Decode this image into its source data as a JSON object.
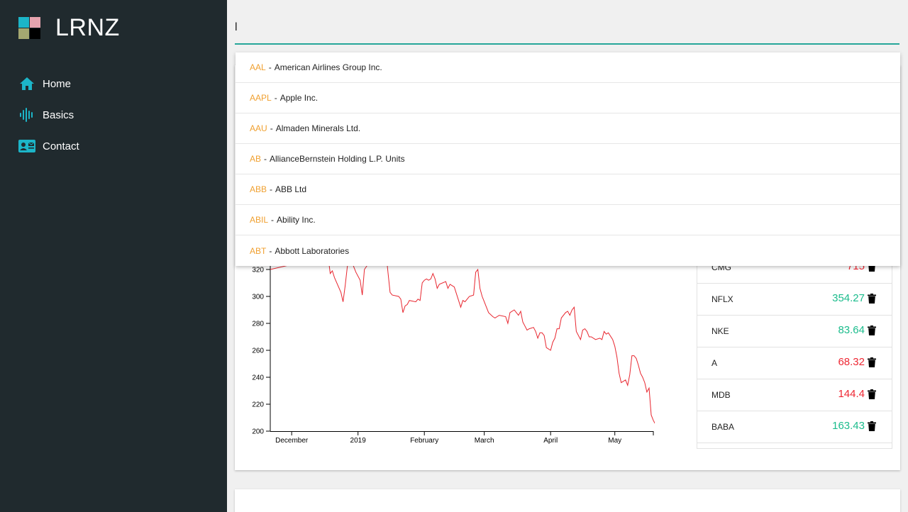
{
  "app": {
    "name": "LRNZ"
  },
  "colors": {
    "sidebar": "#202a2e",
    "accent": "#1cb5c8",
    "search_underline": "#26a69a",
    "symbol": "#f0a030",
    "up": "#1bbc8c",
    "down": "#ee2733",
    "line": "#e8262f"
  },
  "nav": {
    "items": [
      {
        "label": "Home",
        "icon": "home-icon"
      },
      {
        "label": "Basics",
        "icon": "waveform-icon"
      },
      {
        "label": "Contact",
        "icon": "contact-card-icon"
      }
    ]
  },
  "search": {
    "value": "l",
    "placeholder": ""
  },
  "suggestions": [
    {
      "symbol": "AAL",
      "name": "American Airlines Group Inc."
    },
    {
      "symbol": "AAPL",
      "name": "Apple Inc."
    },
    {
      "symbol": "AAU",
      "name": "Almaden Minerals Ltd."
    },
    {
      "symbol": "AB",
      "name": "AllianceBernstein Holding L.P. Units"
    },
    {
      "symbol": "ABB",
      "name": "ABB Ltd"
    },
    {
      "symbol": "ABIL",
      "name": "Ability Inc."
    },
    {
      "symbol": "ABT",
      "name": "Abbott Laboratories"
    }
  ],
  "watchlist": [
    {
      "symbol": "CMG",
      "price": "715",
      "trend": "down"
    },
    {
      "symbol": "NFLX",
      "price": "354.27",
      "trend": "up"
    },
    {
      "symbol": "NKE",
      "price": "83.64",
      "trend": "up"
    },
    {
      "symbol": "A",
      "price": "68.32",
      "trend": "down"
    },
    {
      "symbol": "MDB",
      "price": "144.4",
      "trend": "down"
    },
    {
      "symbol": "BABA",
      "price": "163.43",
      "trend": "up"
    }
  ],
  "chart_data": {
    "type": "line",
    "xlabel": "",
    "ylabel": "",
    "ylim": [
      200,
      340
    ],
    "yticks": [
      200,
      220,
      240,
      260,
      280,
      300,
      320
    ],
    "xticks": [
      {
        "label": "December",
        "date": "2018-12-01"
      },
      {
        "label": "2019",
        "date": "2019-01-01"
      },
      {
        "label": "February",
        "date": "2019-02-01"
      },
      {
        "label": "March",
        "date": "2019-03-01"
      },
      {
        "label": "April",
        "date": "2019-04-01"
      },
      {
        "label": "May",
        "date": "2019-05-01"
      }
    ],
    "xrange": [
      "2018-11-21",
      "2019-05-19"
    ],
    "series": [
      {
        "points": [
          [
            "2018-11-21",
            320
          ],
          [
            "2018-12-18",
            330
          ],
          [
            "2018-12-19",
            317
          ],
          [
            "2018-12-20",
            319
          ],
          [
            "2018-12-21",
            314
          ],
          [
            "2018-12-24",
            303
          ],
          [
            "2018-12-25",
            296
          ],
          [
            "2018-12-26",
            308
          ],
          [
            "2018-12-27",
            322
          ],
          [
            "2018-12-28",
            330
          ],
          [
            "2018-12-31",
            318
          ],
          [
            "2019-01-02",
            312
          ],
          [
            "2019-01-03",
            301
          ],
          [
            "2019-01-04",
            320
          ],
          [
            "2019-01-07",
            327
          ],
          [
            "2019-01-14",
            334
          ],
          [
            "2019-01-15",
            318
          ],
          [
            "2019-01-16",
            303
          ],
          [
            "2019-01-17",
            301
          ],
          [
            "2019-01-20",
            300
          ],
          [
            "2019-01-21",
            298
          ],
          [
            "2019-01-22",
            288
          ],
          [
            "2019-01-23",
            293
          ],
          [
            "2019-01-24",
            294
          ],
          [
            "2019-01-25",
            297
          ],
          [
            "2019-01-28",
            296
          ],
          [
            "2019-01-29",
            298
          ],
          [
            "2019-01-30",
            297
          ],
          [
            "2019-01-31",
            310
          ],
          [
            "2019-02-01",
            312
          ],
          [
            "2019-02-02",
            313
          ],
          [
            "2019-02-03",
            312
          ],
          [
            "2019-02-04",
            313
          ],
          [
            "2019-02-05",
            317
          ],
          [
            "2019-02-06",
            313
          ],
          [
            "2019-02-07",
            306
          ],
          [
            "2019-02-08",
            309
          ],
          [
            "2019-02-11",
            311
          ],
          [
            "2019-02-12",
            306
          ],
          [
            "2019-02-13",
            309
          ],
          [
            "2019-02-14",
            308
          ],
          [
            "2019-02-15",
            307
          ],
          [
            "2019-02-18",
            292
          ],
          [
            "2019-02-19",
            297
          ],
          [
            "2019-02-20",
            296
          ],
          [
            "2019-02-22",
            300
          ],
          [
            "2019-02-24",
            301
          ],
          [
            "2019-02-25",
            318
          ],
          [
            "2019-02-26",
            320
          ],
          [
            "2019-02-27",
            306
          ],
          [
            "2019-02-28",
            300
          ],
          [
            "2019-03-01",
            296
          ],
          [
            "2019-03-03",
            288
          ],
          [
            "2019-03-05",
            285
          ],
          [
            "2019-03-06",
            284
          ],
          [
            "2019-03-08",
            286
          ],
          [
            "2019-03-11",
            285
          ],
          [
            "2019-03-12",
            280
          ],
          [
            "2019-03-13",
            288
          ],
          [
            "2019-03-15",
            290
          ],
          [
            "2019-03-17",
            286
          ],
          [
            "2019-03-18",
            289
          ],
          [
            "2019-03-19",
            281
          ],
          [
            "2019-03-20",
            278
          ],
          [
            "2019-03-21",
            275
          ],
          [
            "2019-03-22",
            276
          ],
          [
            "2019-03-24",
            277
          ],
          [
            "2019-03-25",
            274
          ],
          [
            "2019-03-26",
            269
          ],
          [
            "2019-03-27",
            273
          ],
          [
            "2019-03-28",
            273
          ],
          [
            "2019-03-29",
            271
          ],
          [
            "2019-03-30",
            262
          ],
          [
            "2019-04-01",
            260
          ],
          [
            "2019-04-02",
            266
          ],
          [
            "2019-04-03",
            269
          ],
          [
            "2019-04-04",
            276
          ],
          [
            "2019-04-05",
            276
          ],
          [
            "2019-04-06",
            284
          ],
          [
            "2019-04-08",
            288
          ],
          [
            "2019-04-09",
            289
          ],
          [
            "2019-04-10",
            286
          ],
          [
            "2019-04-11",
            290
          ],
          [
            "2019-04-12",
            292
          ],
          [
            "2019-04-13",
            274
          ],
          [
            "2019-04-15",
            268
          ],
          [
            "2019-04-16",
            275
          ],
          [
            "2019-04-17",
            276
          ],
          [
            "2019-04-18",
            274
          ],
          [
            "2019-04-19",
            270
          ],
          [
            "2019-04-20",
            270
          ],
          [
            "2019-04-22",
            268
          ],
          [
            "2019-04-24",
            269
          ],
          [
            "2019-04-25",
            268
          ],
          [
            "2019-04-26",
            274
          ],
          [
            "2019-04-27",
            272
          ],
          [
            "2019-04-28",
            273
          ],
          [
            "2019-04-30",
            268
          ],
          [
            "2019-05-01",
            263
          ],
          [
            "2019-05-02",
            255
          ],
          [
            "2019-05-03",
            243
          ],
          [
            "2019-05-04",
            236
          ],
          [
            "2019-05-05",
            237
          ],
          [
            "2019-05-06",
            238
          ],
          [
            "2019-05-07",
            234
          ],
          [
            "2019-05-08",
            242
          ],
          [
            "2019-05-09",
            256
          ],
          [
            "2019-05-10",
            256
          ],
          [
            "2019-05-11",
            254
          ],
          [
            "2019-05-12",
            249
          ],
          [
            "2019-05-13",
            243
          ],
          [
            "2019-05-14",
            240
          ],
          [
            "2019-05-15",
            236
          ],
          [
            "2019-05-16",
            229
          ],
          [
            "2019-05-17",
            232
          ],
          [
            "2019-05-18",
            212
          ],
          [
            "2019-05-19",
            208
          ],
          [
            "2019-05-20",
            205
          ]
        ]
      }
    ]
  }
}
